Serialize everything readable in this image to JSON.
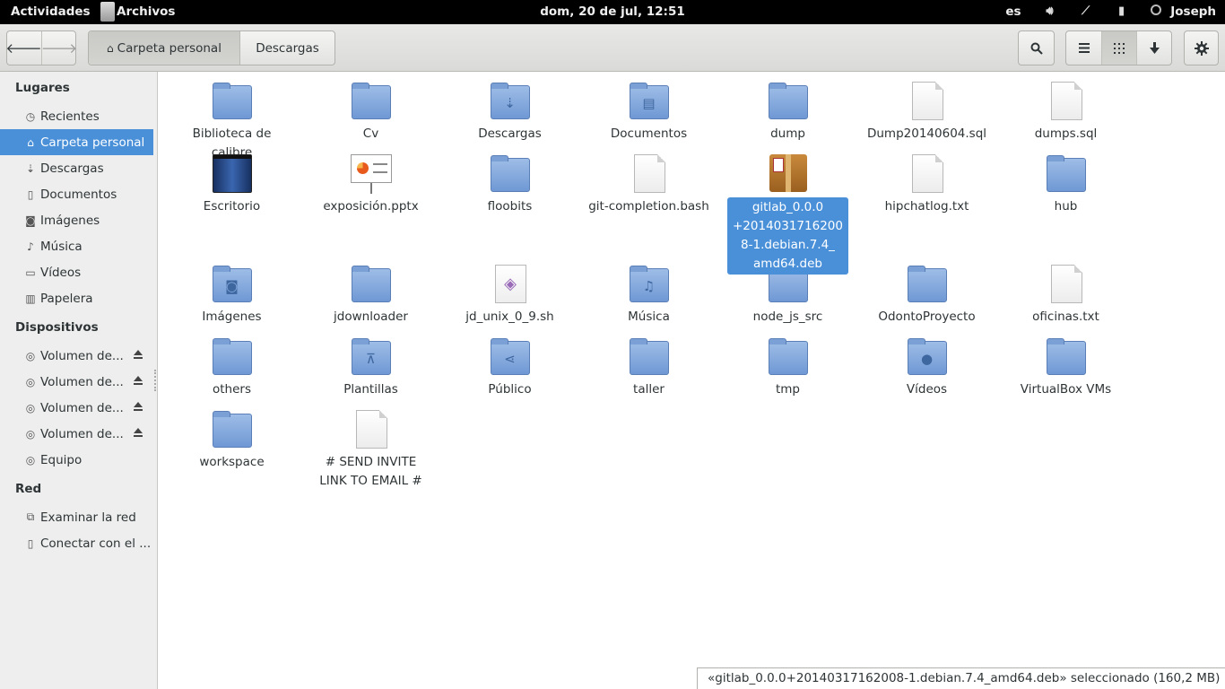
{
  "topbar": {
    "activities": "Actividades",
    "app_name": "Archivos",
    "clock": "dom, 20 de jul, 12:51",
    "language": "es",
    "user": "Joseph"
  },
  "header": {
    "back_icon": "back-arrow-icon",
    "forward_icon": "forward-arrow-icon",
    "path": [
      "Carpeta personal",
      "Descargas"
    ],
    "search_icon": "search-icon",
    "view_icons": [
      "list-view-icon",
      "grid-view-icon",
      "sort-down-icon"
    ],
    "gear_icon": "gear-icon"
  },
  "sidebar": {
    "places_title": "Lugares",
    "places": [
      {
        "label": "Recientes",
        "icon": "recent-icon"
      },
      {
        "label": "Carpeta personal",
        "icon": "home-icon"
      },
      {
        "label": "Descargas",
        "icon": "download-icon"
      },
      {
        "label": "Documentos",
        "icon": "document-icon"
      },
      {
        "label": "Imágenes",
        "icon": "camera-icon"
      },
      {
        "label": "Música",
        "icon": "music-icon"
      },
      {
        "label": "Vídeos",
        "icon": "video-icon"
      },
      {
        "label": "Papelera",
        "icon": "trash-icon"
      }
    ],
    "devices_title": "Dispositivos",
    "devices": [
      {
        "label": "Volumen de..."
      },
      {
        "label": "Volumen de..."
      },
      {
        "label": "Volumen de..."
      },
      {
        "label": "Volumen de..."
      },
      {
        "label": "Equipo"
      }
    ],
    "network_title": "Red",
    "network": [
      {
        "label": "Examinar la red"
      },
      {
        "label": "Conectar con el ..."
      }
    ]
  },
  "files": [
    {
      "name": "Biblioteca de calibre",
      "type": "folder"
    },
    {
      "name": "Cv",
      "type": "folder"
    },
    {
      "name": "Descargas",
      "type": "folder-download"
    },
    {
      "name": "Documentos",
      "type": "folder-documents"
    },
    {
      "name": "dump",
      "type": "folder"
    },
    {
      "name": "Dump20140604.sql",
      "type": "text"
    },
    {
      "name": "dumps.sql",
      "type": "text"
    },
    {
      "name": "Escritorio",
      "type": "desktop"
    },
    {
      "name": "exposición.pptx",
      "type": "presentation"
    },
    {
      "name": "floobits",
      "type": "folder"
    },
    {
      "name": "git-completion.bash",
      "type": "text"
    },
    {
      "name": "gitlab_0.0.0+20140317162008-1.debian.7.4_amd64.deb",
      "type": "package",
      "label_lines": [
        "gitlab_0.0.0",
        "+2014031716200",
        "8-1.debian.7.4_",
        "amd64.deb"
      ]
    },
    {
      "name": "hipchatlog.txt",
      "type": "text"
    },
    {
      "name": "hub",
      "type": "folder"
    },
    {
      "name": "Imágenes",
      "type": "folder-pictures"
    },
    {
      "name": "jdownloader",
      "type": "folder"
    },
    {
      "name": "jd_unix_0_9.sh",
      "type": "script"
    },
    {
      "name": "Música",
      "type": "folder-music"
    },
    {
      "name": "node_js_src",
      "type": "folder"
    },
    {
      "name": "OdontoProyecto",
      "type": "folder"
    },
    {
      "name": "oficinas.txt",
      "type": "text"
    },
    {
      "name": "others",
      "type": "folder"
    },
    {
      "name": "Plantillas",
      "type": "folder-templates"
    },
    {
      "name": "Público",
      "type": "folder-public"
    },
    {
      "name": "taller",
      "type": "folder"
    },
    {
      "name": "tmp",
      "type": "folder"
    },
    {
      "name": "Vídeos",
      "type": "folder-videos"
    },
    {
      "name": "VirtualBox VMs",
      "type": "folder"
    },
    {
      "name": "workspace",
      "type": "folder"
    },
    {
      "name": "# SEND INVITE LINK TO EMAIL #",
      "type": "text",
      "label_lines": [
        "# SEND INVITE",
        "LINK TO EMAIL #"
      ]
    }
  ],
  "status": "«gitlab_0.0.0+20140317162008-1.debian.7.4_amd64.deb» seleccionado (160,2 MB)",
  "colors": {
    "selection": "#4a90d9",
    "folder": "#7aa0d6",
    "topbar": "#000000"
  }
}
